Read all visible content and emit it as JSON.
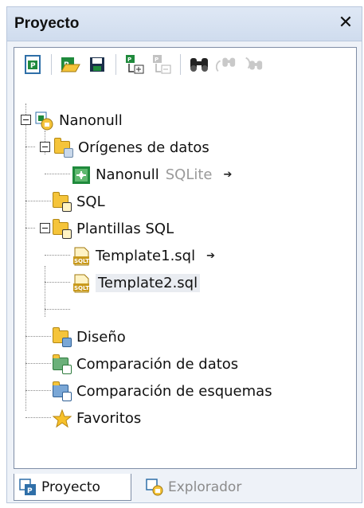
{
  "panel": {
    "title": "Proyecto",
    "close_glyph": "✕"
  },
  "toolbar": {
    "buttons": [
      {
        "icon": "new-project-icon",
        "enabled": true
      },
      {
        "icon": "open-project-icon",
        "enabled": true
      },
      {
        "icon": "save-project-icon",
        "enabled": true
      },
      {
        "icon": "add-to-project-icon",
        "enabled": true
      },
      {
        "icon": "remove-from-project-icon",
        "enabled": false
      },
      {
        "icon": "find-icon",
        "enabled": true
      },
      {
        "icon": "find-next-icon",
        "enabled": false
      },
      {
        "icon": "find-previous-icon",
        "enabled": false
      }
    ]
  },
  "tree": {
    "root": "Nanonull",
    "datasources": "Orígenes de datos",
    "datasource_item": "Nanonull",
    "datasource_type": "SQLite",
    "sql": "SQL",
    "templates": "Plantillas SQL",
    "template1": "Template1.sql",
    "template2": "Template2.sql",
    "design": "Diseño",
    "data_compare": "Comparación de datos",
    "schema_compare": "Comparación de esquemas",
    "favorites": "Favoritos",
    "arrow_glyph": "➔",
    "sqlt_badge": "SQLT"
  },
  "tabs": {
    "project": "Proyecto",
    "explorer": "Explorador"
  },
  "colors": {
    "title_bg": "#d6e1f1",
    "folder": "#f5c43a",
    "selection": "#e9ecf1"
  }
}
